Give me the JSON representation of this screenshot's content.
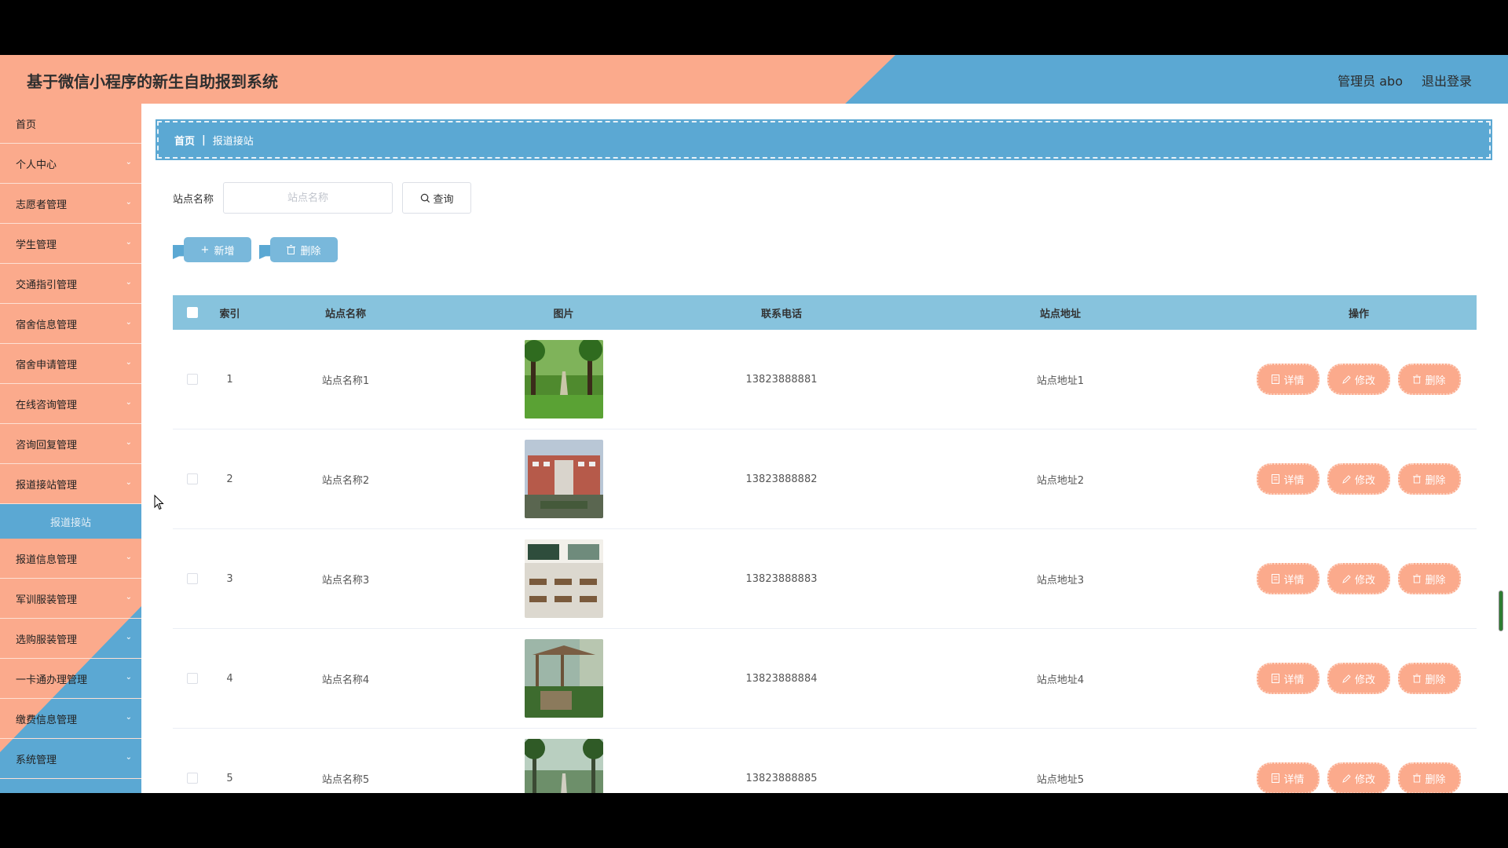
{
  "header": {
    "title": "基于微信小程序的新生自助报到系统",
    "user": "管理员 abo",
    "logout": "退出登录"
  },
  "sidebar": {
    "items": [
      {
        "label": "首页",
        "name": "sidebar-item-home",
        "expandable": false
      },
      {
        "label": "个人中心",
        "name": "sidebar-item-personal-center",
        "expandable": true
      },
      {
        "label": "志愿者管理",
        "name": "sidebar-item-volunteer",
        "expandable": true
      },
      {
        "label": "学生管理",
        "name": "sidebar-item-student",
        "expandable": true
      },
      {
        "label": "交通指引管理",
        "name": "sidebar-item-traffic-guide",
        "expandable": true
      },
      {
        "label": "宿舍信息管理",
        "name": "sidebar-item-dorm-info",
        "expandable": true
      },
      {
        "label": "宿舍申请管理",
        "name": "sidebar-item-dorm-apply",
        "expandable": true
      },
      {
        "label": "在线咨询管理",
        "name": "sidebar-item-online-consult",
        "expandable": true
      },
      {
        "label": "咨询回复管理",
        "name": "sidebar-item-consult-reply",
        "expandable": true
      },
      {
        "label": "报道接站管理",
        "name": "sidebar-item-pickup-station",
        "expandable": true
      },
      {
        "label": "报道接站",
        "name": "sidebar-subitem-pickup-station",
        "sub": true
      },
      {
        "label": "报道信息管理",
        "name": "sidebar-item-report-info",
        "expandable": true
      },
      {
        "label": "军训服装管理",
        "name": "sidebar-item-military-clothes",
        "expandable": true
      },
      {
        "label": "选购服装管理",
        "name": "sidebar-item-purchase-clothes",
        "expandable": true
      },
      {
        "label": "一卡通办理管理",
        "name": "sidebar-item-campus-card",
        "expandable": true
      },
      {
        "label": "缴费信息管理",
        "name": "sidebar-item-payment-info",
        "expandable": true
      },
      {
        "label": "系统管理",
        "name": "sidebar-item-system",
        "expandable": true
      }
    ]
  },
  "breadcrumb": {
    "home": "首页",
    "sep": "|",
    "current": "报道接站"
  },
  "search": {
    "label": "站点名称",
    "placeholder": "站点名称",
    "query_label": "查询"
  },
  "actions": {
    "add_label": "新增",
    "delete_label": "删除"
  },
  "table": {
    "columns": {
      "index": "索引",
      "name": "站点名称",
      "image": "图片",
      "phone": "联系电话",
      "address": "站点地址",
      "ops": "操作"
    },
    "op_labels": {
      "detail": "详情",
      "edit": "修改",
      "delete": "删除"
    },
    "rows": [
      {
        "index": "1",
        "name": "站点名称1",
        "phone": "13823888881",
        "address": "站点地址1"
      },
      {
        "index": "2",
        "name": "站点名称2",
        "phone": "13823888882",
        "address": "站点地址2"
      },
      {
        "index": "3",
        "name": "站点名称3",
        "phone": "13823888883",
        "address": "站点地址3"
      },
      {
        "index": "4",
        "name": "站点名称4",
        "phone": "13823888884",
        "address": "站点地址4"
      },
      {
        "index": "5",
        "name": "站点名称5",
        "phone": "13823888885",
        "address": "站点地址5"
      }
    ]
  },
  "colors": {
    "salmon": "#fbaa8c",
    "blue": "#5ba8d3",
    "table_header": "#87c3dd"
  }
}
